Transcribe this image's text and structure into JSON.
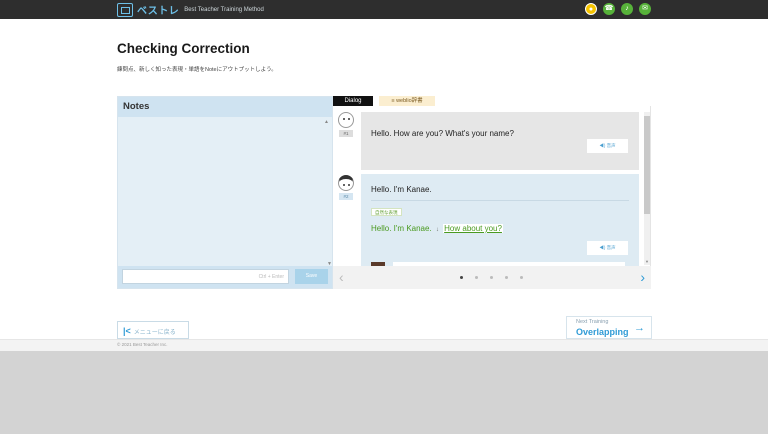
{
  "header": {
    "brand": "ベストレ",
    "tagline": "Best Teacher Training Method",
    "icons": [
      "avatar-icon",
      "phone-icon",
      "mic-icon",
      "chat-icon"
    ],
    "icon_colors": [
      "#f5c400",
      "#57b23a",
      "#57b23a",
      "#57b23a"
    ]
  },
  "page": {
    "title": "Checking Correction",
    "subtitle": "練問点、新しく知った表現・単語をNoteにアウトプットしよう。"
  },
  "notes": {
    "heading": "Notes",
    "input_placeholder": "Ctrl + Enter",
    "save_label": "Save"
  },
  "tabs": {
    "dialog": "Dialog",
    "weblio": "≡ weblio辞書"
  },
  "dialog": {
    "messages": [
      {
        "speaker": "#1",
        "text": "Hello. How are you? What's your name?",
        "voice_label": "◀) 音声"
      },
      {
        "speaker": "#2",
        "text": "Hello. I'm Kanae.",
        "badge": "自然な表現",
        "correction_prefix": "Hello. I'm Kanae.",
        "insert_mark": "↓",
        "correction_link": "How about you?",
        "voice_label": "◀) 音声"
      }
    ]
  },
  "pager": {
    "prev": "‹",
    "next": "›",
    "pages": 5,
    "current": 1
  },
  "nav": {
    "menu_back": "メニューに戻る",
    "menu_chevron": "|<",
    "next_label": "Next Training",
    "next_title": "Overlapping",
    "next_arrow": "→"
  },
  "footer": {
    "copyright": "© 2021 Best Teacher Inc."
  }
}
